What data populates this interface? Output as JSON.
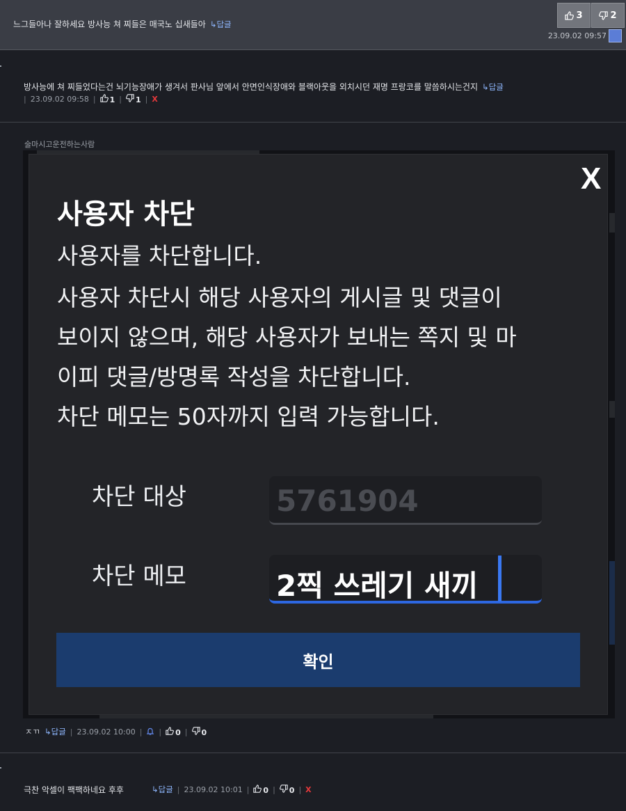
{
  "comments": [
    {
      "text": "느그들아나 잘하세요 방사능 쳐 찌들은 매국노 십새들아",
      "reply_label": "↳답글",
      "upvotes": "3",
      "downvotes": "2",
      "date": "23.09.02 09:57"
    },
    {
      "text": "방사능에 쳐 찌들었다는건 뇌기능장애가 생겨서 판사님 앞에서 안면인식장애와 블랙아웃을 외치시던 재명 프랑코를 말씀하시는건지",
      "reply_label": "↳답글",
      "date": "23.09.02 09:58",
      "upvotes": "1",
      "downvotes": "1",
      "delete_label": "X"
    },
    {
      "author": "술마시고운전하는사람",
      "text": "ㅈㄲ",
      "reply_label": "↳답글",
      "date": "23.09.02 10:00",
      "upvotes": "0",
      "downvotes": "0"
    },
    {
      "text": "극찬 악셀이 팩팩하네요 후후",
      "reply_label": "↳답글",
      "date": "23.09.02 10:01",
      "upvotes": "0",
      "downvotes": "0",
      "delete_label": "X"
    }
  ],
  "modal": {
    "close_label": "X",
    "title": "사용자 차단",
    "lines": [
      "사용자를 차단합니다.",
      "사용자 차단시 해당 사용자의 게시글 및 댓글이",
      "보이지 않으며, 해당 사용자가 보내는 쪽지 및 마",
      "이피 댓글/방명록 작성을 차단합니다.",
      "차단 메모는 50자까지 입력 가능합니다."
    ],
    "target_label": "차단 대상",
    "target_value": "5761904",
    "memo_label": "차단 메모",
    "memo_value": "2찍 쓰레기 새끼",
    "confirm_label": "확인"
  },
  "icons": {
    "thumbs_up": "thumbs-up-icon",
    "thumbs_down": "thumbs-down-icon",
    "avatar": "avatar-icon",
    "bell": "alarm-icon"
  },
  "colors": {
    "accent": "#2d67e1",
    "confirm_button": "#1b3c6e",
    "delete": "#e5383b",
    "reply_link": "#8fb8ff"
  }
}
